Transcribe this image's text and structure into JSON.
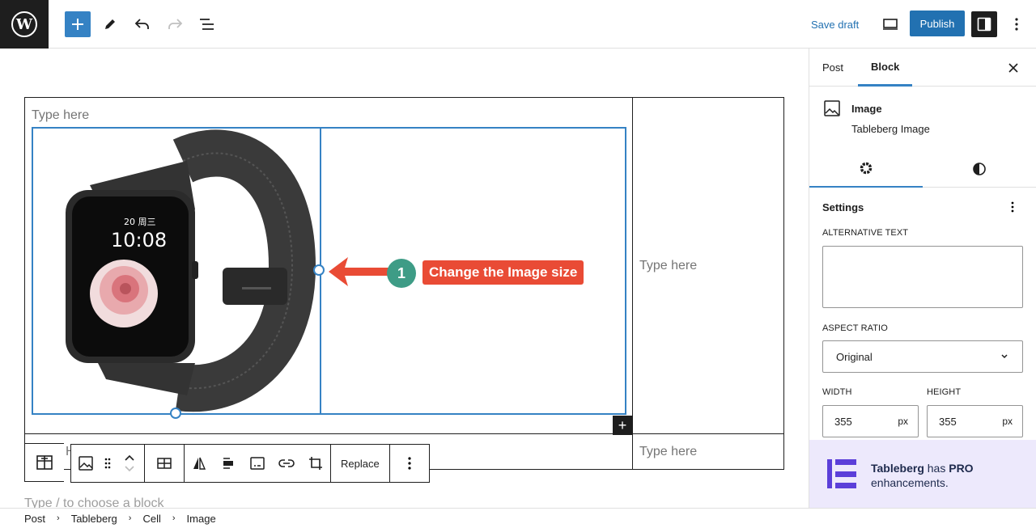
{
  "toolbar": {
    "save_draft": "Save draft",
    "publish": "Publish"
  },
  "canvas": {
    "cell_placeholder": "Type here",
    "right_cell_placeholder": "Type here",
    "bottom_right_placeholder": "Type here",
    "bottom_left_partial": "H",
    "appender_placeholder": "Type / to choose a block",
    "callout_number": "1",
    "callout_text": "Change the Image size",
    "watch_time": "10:08",
    "watch_date": "20 周三"
  },
  "block_toolbar": {
    "replace": "Replace"
  },
  "sidebar": {
    "tabs": [
      "Post",
      "Block"
    ],
    "active_tab": "Block",
    "block_title": "Image",
    "block_subtitle": "Tableberg Image",
    "settings_title": "Settings",
    "alt_text_label": "ALTERNATIVE TEXT",
    "alt_text_value": "",
    "aspect_ratio_label": "ASPECT RATIO",
    "aspect_ratio_value": "Original",
    "width_label": "WIDTH",
    "height_label": "HEIGHT",
    "width_value": "355",
    "height_value": "355",
    "unit": "px"
  },
  "promo": {
    "brand": "Tableberg",
    "has": " has ",
    "pro": "PRO",
    "line2": "enhancements."
  },
  "breadcrumb": [
    "Post",
    "Tableberg",
    "Cell",
    "Image"
  ],
  "colors": {
    "accent": "#3582c4",
    "callout_red": "#e94b35",
    "callout_green": "#3e9c86",
    "promo_bg": "#ede9fc"
  }
}
